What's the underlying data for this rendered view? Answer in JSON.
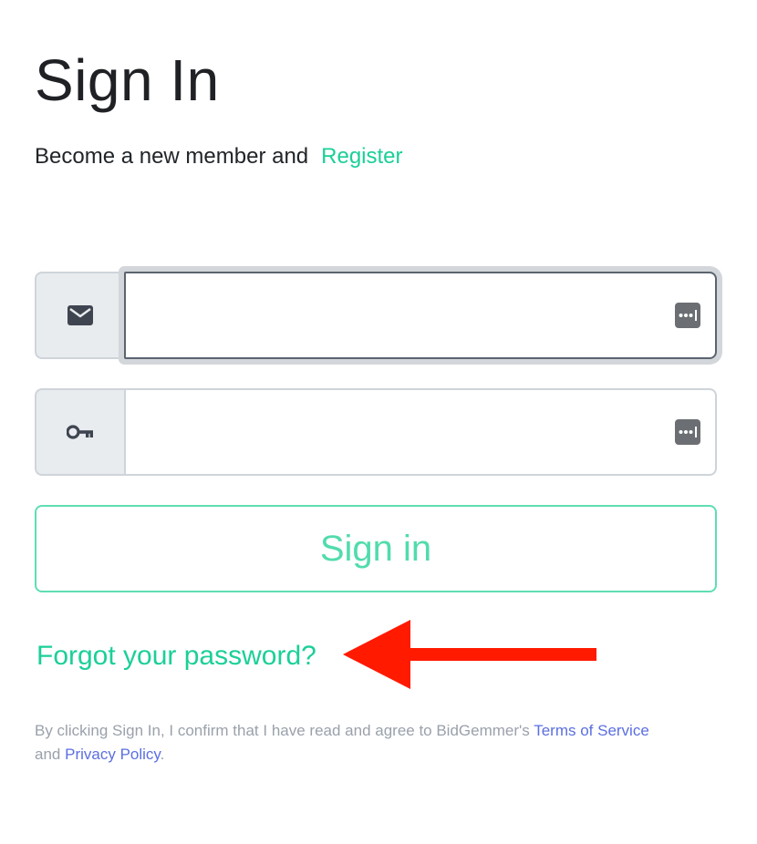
{
  "page": {
    "title": "Sign In",
    "register_prompt": "Become a new member and",
    "register_link": "Register"
  },
  "form": {
    "email": {
      "icon": "envelope-icon",
      "value": "",
      "placeholder": ""
    },
    "password": {
      "icon": "key-icon",
      "value": "",
      "placeholder": ""
    },
    "password_manager_icon": "password-manager-icon",
    "submit_label": "Sign in",
    "forgot_password": "Forgot your password?"
  },
  "legal": {
    "prefix": "By clicking Sign In, I confirm that I have read and agree to BidGemmer's",
    "terms_link": "Terms of Service",
    "conjunction": "and",
    "privacy_link": "Privacy Policy",
    "suffix": "."
  },
  "colors": {
    "accent": "#1bcf98",
    "button_text": "#52dcab",
    "link_blue": "#5b6fe0",
    "annotation_arrow": "#ff1a00"
  }
}
